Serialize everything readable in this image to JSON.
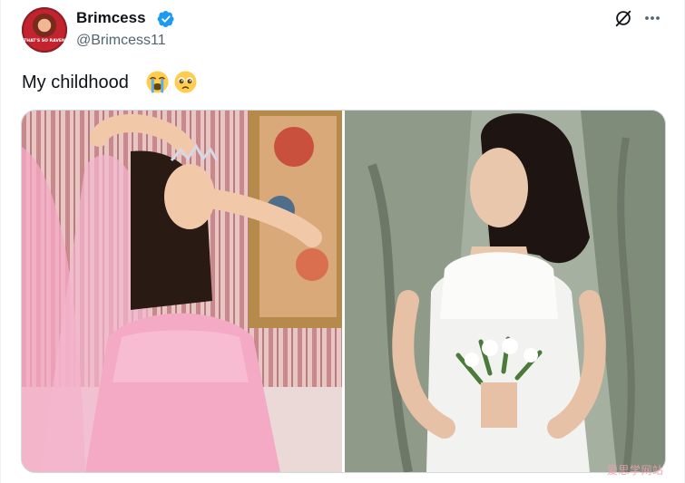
{
  "post": {
    "display_name": "Brimcess",
    "handle": "@Brimcess11",
    "verified": true,
    "text": "My childhood",
    "emojis": [
      "loudly-crying-face",
      "pleading-face"
    ],
    "avatar_caption": "THAT'S SO RAVEN"
  },
  "media": {
    "photos": [
      {
        "description": "pink-quinceanera-dress-with-veil-and-tiara"
      },
      {
        "description": "white-halter-gown-with-bouquet"
      }
    ]
  },
  "icons": {
    "grok": "grok-icon",
    "more": "more-icon",
    "verified": "verified-badge-icon"
  },
  "watermark": "爱思学网站",
  "colors": {
    "verified_blue": "#1d9bf0",
    "text_primary": "#0f1419",
    "text_secondary": "#536471",
    "border": "#cfd9de"
  }
}
